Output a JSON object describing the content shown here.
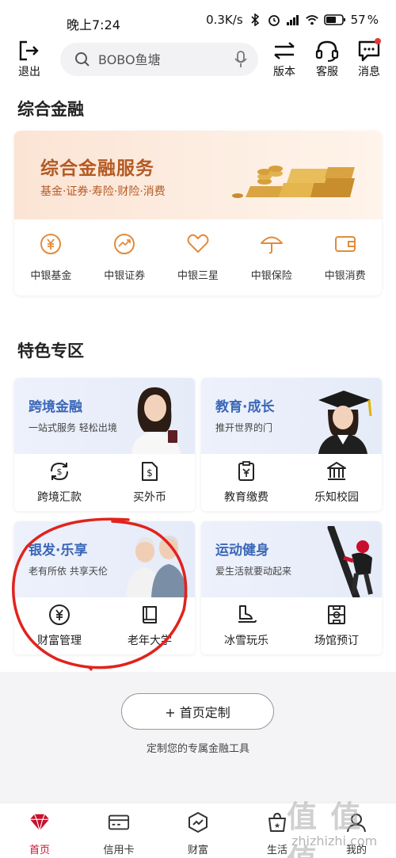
{
  "status_bar": {
    "time": "晚上7:24",
    "network_speed": "0.3K/s",
    "battery": "57"
  },
  "top_bar": {
    "logout_label": "退出",
    "search_placeholder": "BOBO鱼塘",
    "version_label": "版本",
    "service_label": "客服",
    "message_label": "消息"
  },
  "finance_section": {
    "title": "综合金融",
    "banner_title": "综合金融服务",
    "banner_subtitle": "基金·证券·寿险·财险·消费",
    "items": [
      {
        "label": "中银基金",
        "icon": "yuan-circle-icon"
      },
      {
        "label": "中银证券",
        "icon": "trend-chart-icon"
      },
      {
        "label": "中银三星",
        "icon": "heart-icon"
      },
      {
        "label": "中银保险",
        "icon": "umbrella-icon"
      },
      {
        "label": "中银消费",
        "icon": "wallet-icon"
      }
    ]
  },
  "special_section": {
    "title": "特色专区",
    "cards": [
      {
        "title": "跨境金融",
        "subtitle": "一站式服务 轻松出境",
        "buttons": [
          {
            "label": "跨境汇款",
            "icon": "dollar-exchange-icon"
          },
          {
            "label": "买外币",
            "icon": "dollar-document-icon"
          }
        ]
      },
      {
        "title": "教育·成长",
        "subtitle": "推开世界的门",
        "buttons": [
          {
            "label": "教育缴费",
            "icon": "yuan-clipboard-icon"
          },
          {
            "label": "乐知校园",
            "icon": "school-building-icon"
          }
        ]
      },
      {
        "title": "银发·乐享",
        "subtitle": "老有所依 共享天伦",
        "buttons": [
          {
            "label": "财富管理",
            "icon": "yuan-circle-icon"
          },
          {
            "label": "老年大学",
            "icon": "book-icon"
          }
        ]
      },
      {
        "title": "运动健身",
        "subtitle": "爱生活就要动起来",
        "buttons": [
          {
            "label": "冰雪玩乐",
            "icon": "skate-icon"
          },
          {
            "label": "场馆预订",
            "icon": "stadium-icon"
          }
        ]
      }
    ]
  },
  "customize": {
    "button_label": "+ 首页定制",
    "subtitle": "定制您的专属金融工具"
  },
  "bottom_nav": {
    "items": [
      {
        "label": "首页",
        "icon": "home-diamond-icon"
      },
      {
        "label": "信用卡",
        "icon": "credit-card-icon"
      },
      {
        "label": "财富",
        "icon": "wealth-icon"
      },
      {
        "label": "生活",
        "icon": "life-bag-icon"
      },
      {
        "label": "我的",
        "icon": "profile-icon"
      }
    ]
  },
  "watermark": {
    "text": "值 值 值",
    "url": "zhizhizhi.com"
  },
  "colors": {
    "brand_red": "#c8102e",
    "banner_orange": "#b45a24",
    "feature_blue": "#3a67b8",
    "annotation_red": "#e0231c"
  }
}
